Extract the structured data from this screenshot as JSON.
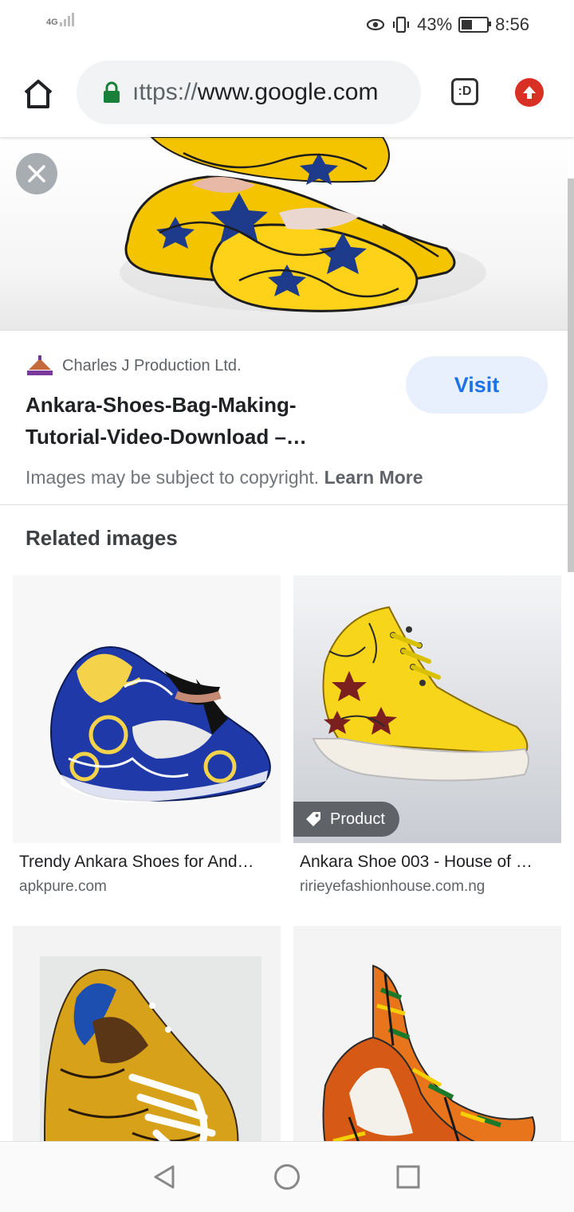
{
  "status_bar": {
    "network": "4G",
    "battery_percent": "43%",
    "battery_level": 0.43,
    "time": "8:56",
    "icons": [
      "signal-icon",
      "eye-icon",
      "vibrate-icon",
      "battery-icon"
    ]
  },
  "toolbar": {
    "url_scheme": "https://",
    "url_display_scheme": "ıttps://",
    "url_host": "www.google.com",
    "tab_switcher_label": ":D",
    "icons": [
      "home-icon",
      "lock-icon",
      "tab-switcher-icon",
      "update-icon"
    ]
  },
  "result": {
    "source_name": "Charles J Production Ltd.",
    "title": "Ankara-Shoes-Bag-Making-Tutorial-Video-Download –…",
    "visit_label": "Visit",
    "copyright_text": "Images may be subject to copyright.",
    "learn_more_label": "Learn More"
  },
  "related": {
    "heading": "Related images",
    "items": [
      {
        "title": "Trendy Ankara Shoes for And…",
        "domain": "apkpure.com",
        "badge": ""
      },
      {
        "title": "Ankara Shoe 003 - House of …",
        "domain": "ririeyefashionhouse.com.ng",
        "badge": "Product"
      },
      {
        "title": "",
        "domain": "",
        "badge": ""
      },
      {
        "title": "",
        "domain": "",
        "badge": ""
      }
    ]
  },
  "colors": {
    "accent": "#1a73e8",
    "visit_bg": "#e8f0fe",
    "update_red": "#d93025",
    "lock_green": "#188038"
  }
}
